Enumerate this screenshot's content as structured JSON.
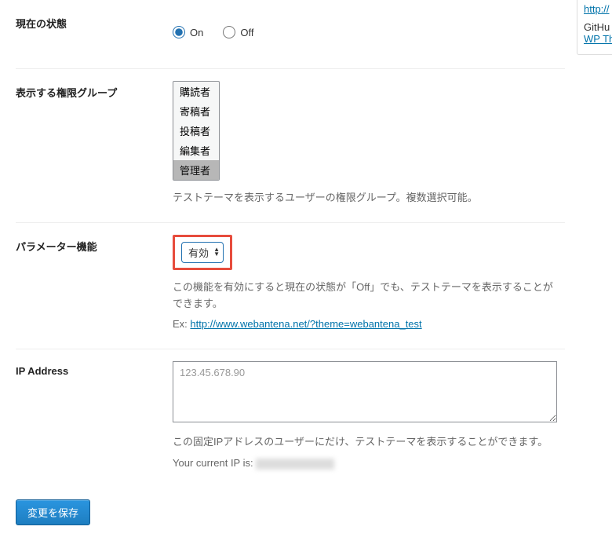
{
  "rows": {
    "state": {
      "label": "現在の状態",
      "on": "On",
      "off": "Off"
    },
    "role_group": {
      "label": "表示する権限グループ",
      "options": [
        "購読者",
        "寄稿者",
        "投稿者",
        "編集者",
        "管理者"
      ],
      "description": "テストテーマを表示するユーザーの権限グループ。複数選択可能。"
    },
    "parameter": {
      "label": "パラメーター機能",
      "select_value": "有効",
      "description": "この機能を有効にすると現在の状態が「Off」でも、テストテーマを表示することができます。",
      "ex_label": "Ex:",
      "ex_url": "http://www.webantena.net/?theme=webantena_test"
    },
    "ip": {
      "label": "IP Address",
      "placeholder": "123.45.678.90",
      "description": "この固定IPアドレスのユーザーにだけ、テストテーマを表示することができます。",
      "current_label": "Your current IP is:"
    }
  },
  "submit_label": "変更を保存",
  "sidebar": {
    "link1": "http://",
    "github_label": "GitHu",
    "link2": "WP Th"
  }
}
